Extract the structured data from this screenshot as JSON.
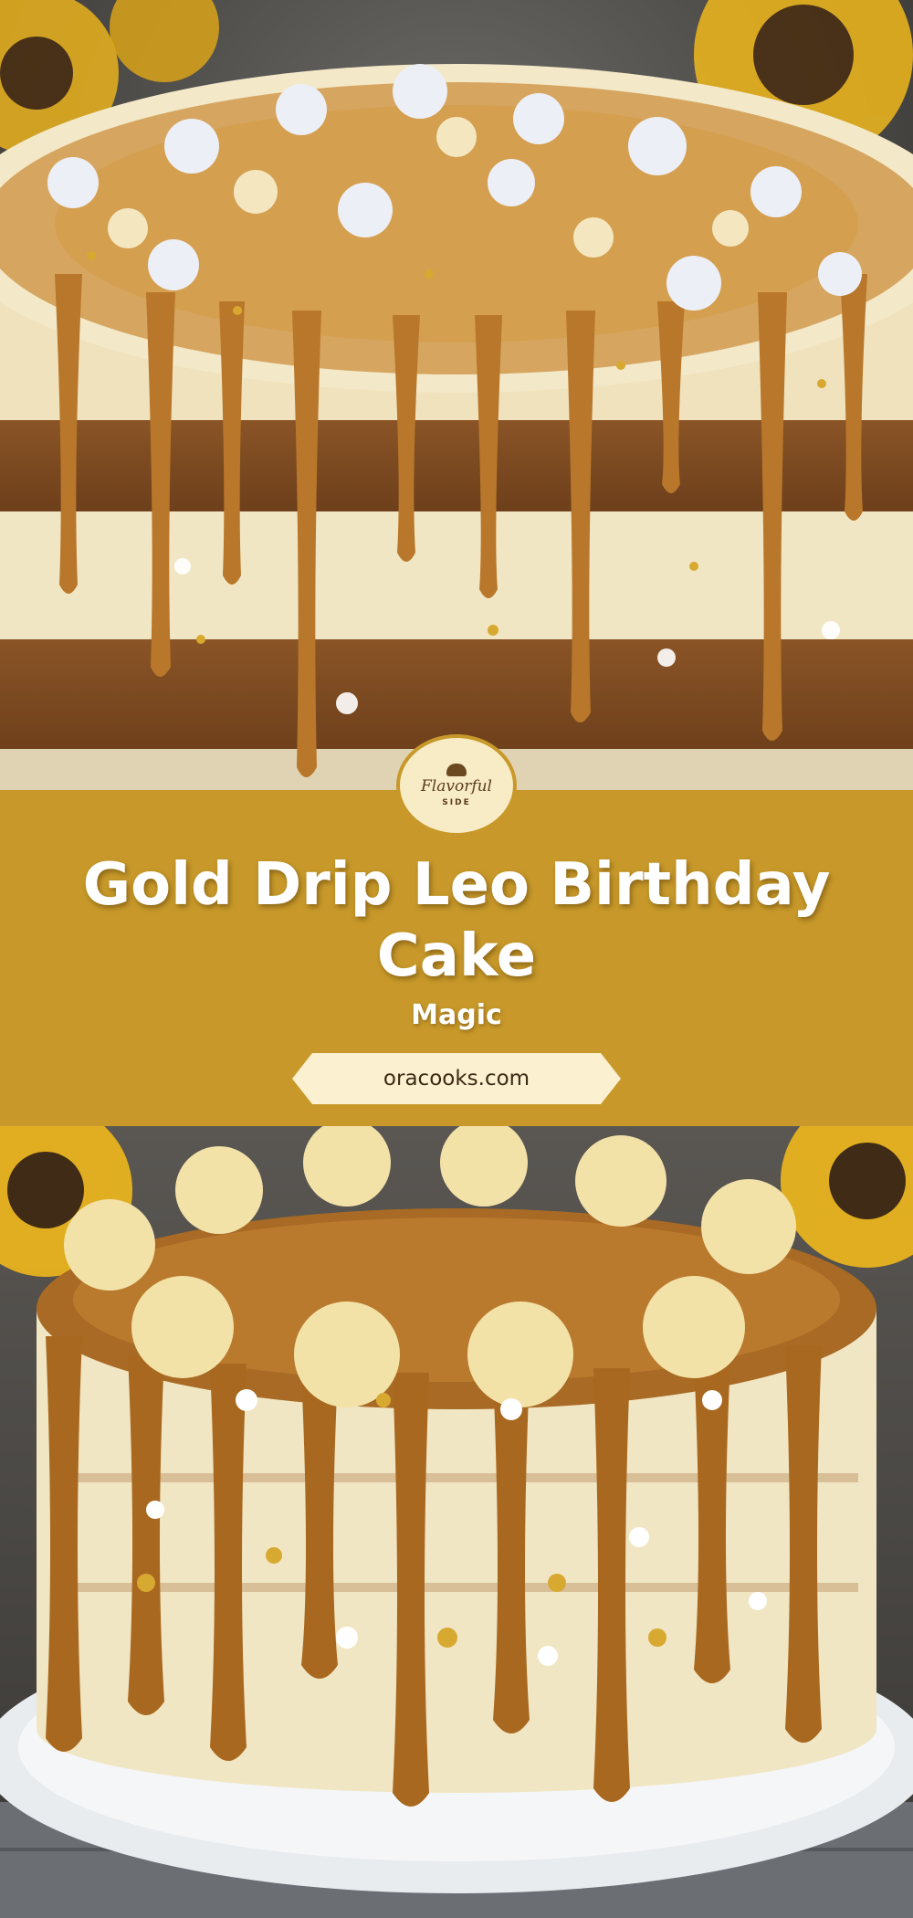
{
  "logo": {
    "name": "Flavorful",
    "tagline": "SIDE",
    "icon": "chef-hat-icon"
  },
  "title": "Gold Drip Leo Birthday Cake",
  "subtitle": "Magic",
  "website": "oracooks.com",
  "colors": {
    "banner": "#c8992a",
    "caramel": "#b5782a",
    "frosting": "#f1e6c4",
    "sunflower": "#f0b81c"
  }
}
